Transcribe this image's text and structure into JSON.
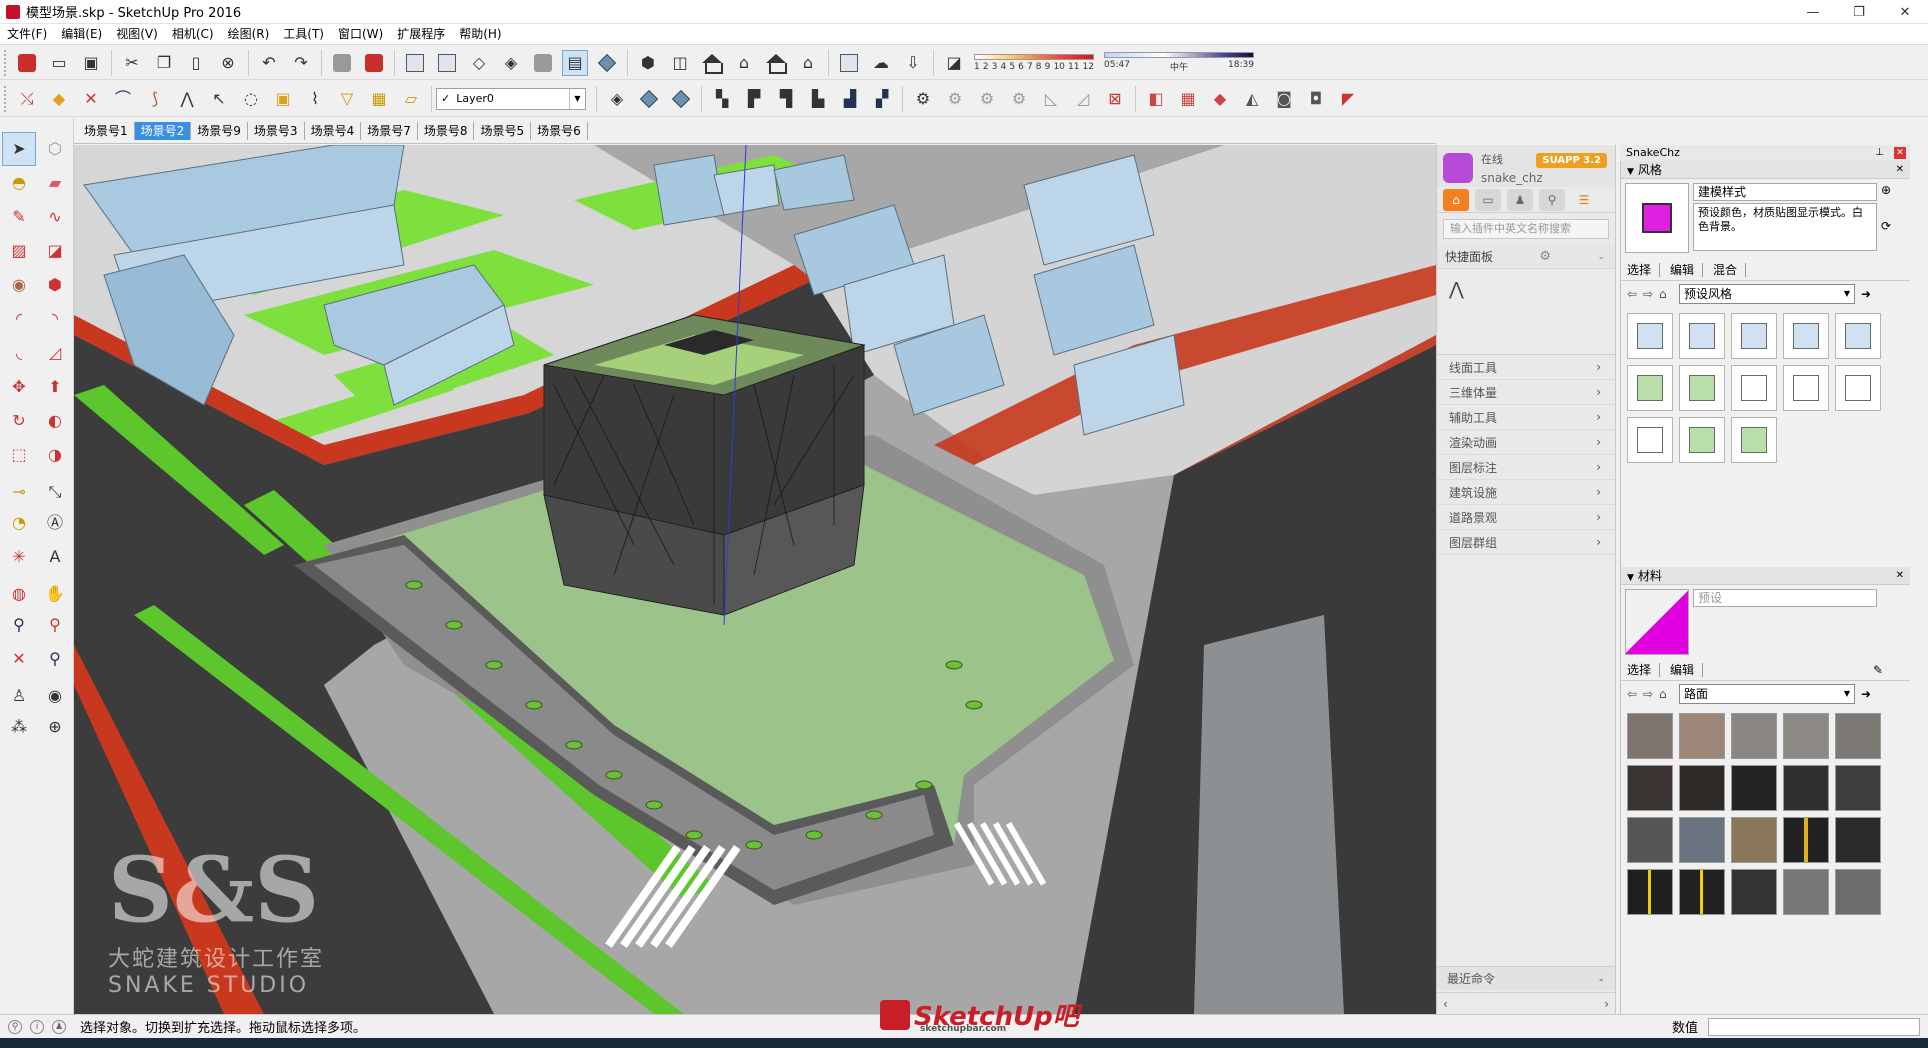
{
  "window": {
    "title": "模型场景.skp - SketchUp Pro 2016",
    "controls": [
      "—",
      "❐",
      "✕"
    ]
  },
  "menus": [
    "文件(F)",
    "编辑(E)",
    "视图(V)",
    "相机(C)",
    "绘图(R)",
    "工具(T)",
    "窗口(W)",
    "扩展程序",
    "帮助(H)"
  ],
  "toolbar": {
    "shadow_scale": [
      "1",
      "2",
      "3",
      "4",
      "5",
      "6",
      "7",
      "8",
      "9",
      "10",
      "11",
      "12"
    ],
    "time_start": "05:47",
    "time_mid": "中午",
    "time_end": "18:39",
    "layer_value": "Layer0",
    "layer_check": "✓"
  },
  "scenes": {
    "tabs": [
      "场景号1",
      "场景号2",
      "场景号9",
      "场景号3",
      "场景号4",
      "场景号7",
      "场景号8",
      "场景号5",
      "场景号6"
    ],
    "active_index": 1
  },
  "viewport": {
    "watermark_logo": "S&S",
    "watermark_cn": "大蛇建筑设计工作室",
    "watermark_en": "SNAKE STUDIO"
  },
  "plugin": {
    "status": "在线",
    "user": "snake_chz",
    "badge": "SUAPP 3.2",
    "search_placeholder": "输入插件中英文名称搜索",
    "quick_panel": "快捷面板",
    "menu_items": [
      "线面工具",
      "三维体量",
      "辅助工具",
      "渲染动画",
      "图层标注",
      "建筑设施",
      "道路景观",
      "图层群组"
    ],
    "recent": "最近命令"
  },
  "tray": {
    "title": "SnakeChz",
    "styles": {
      "header": "风格",
      "name": "建模样式",
      "description": "预设颜色，材质贴图显示模式。白色背景。",
      "tabs": [
        "选择",
        "编辑",
        "混合"
      ],
      "collection": "预设风格"
    },
    "materials": {
      "header": "材料",
      "name_placeholder": "预设",
      "tabs": [
        "选择",
        "编辑"
      ],
      "collection": "路面"
    }
  },
  "status": {
    "message": "选择对象。切换到扩充选择。拖动鼠标选择多项。",
    "vcb_label": "数值"
  },
  "branding": {
    "logo_text": "SketchUp吧",
    "logo_sub": "sketchupbar.com"
  }
}
